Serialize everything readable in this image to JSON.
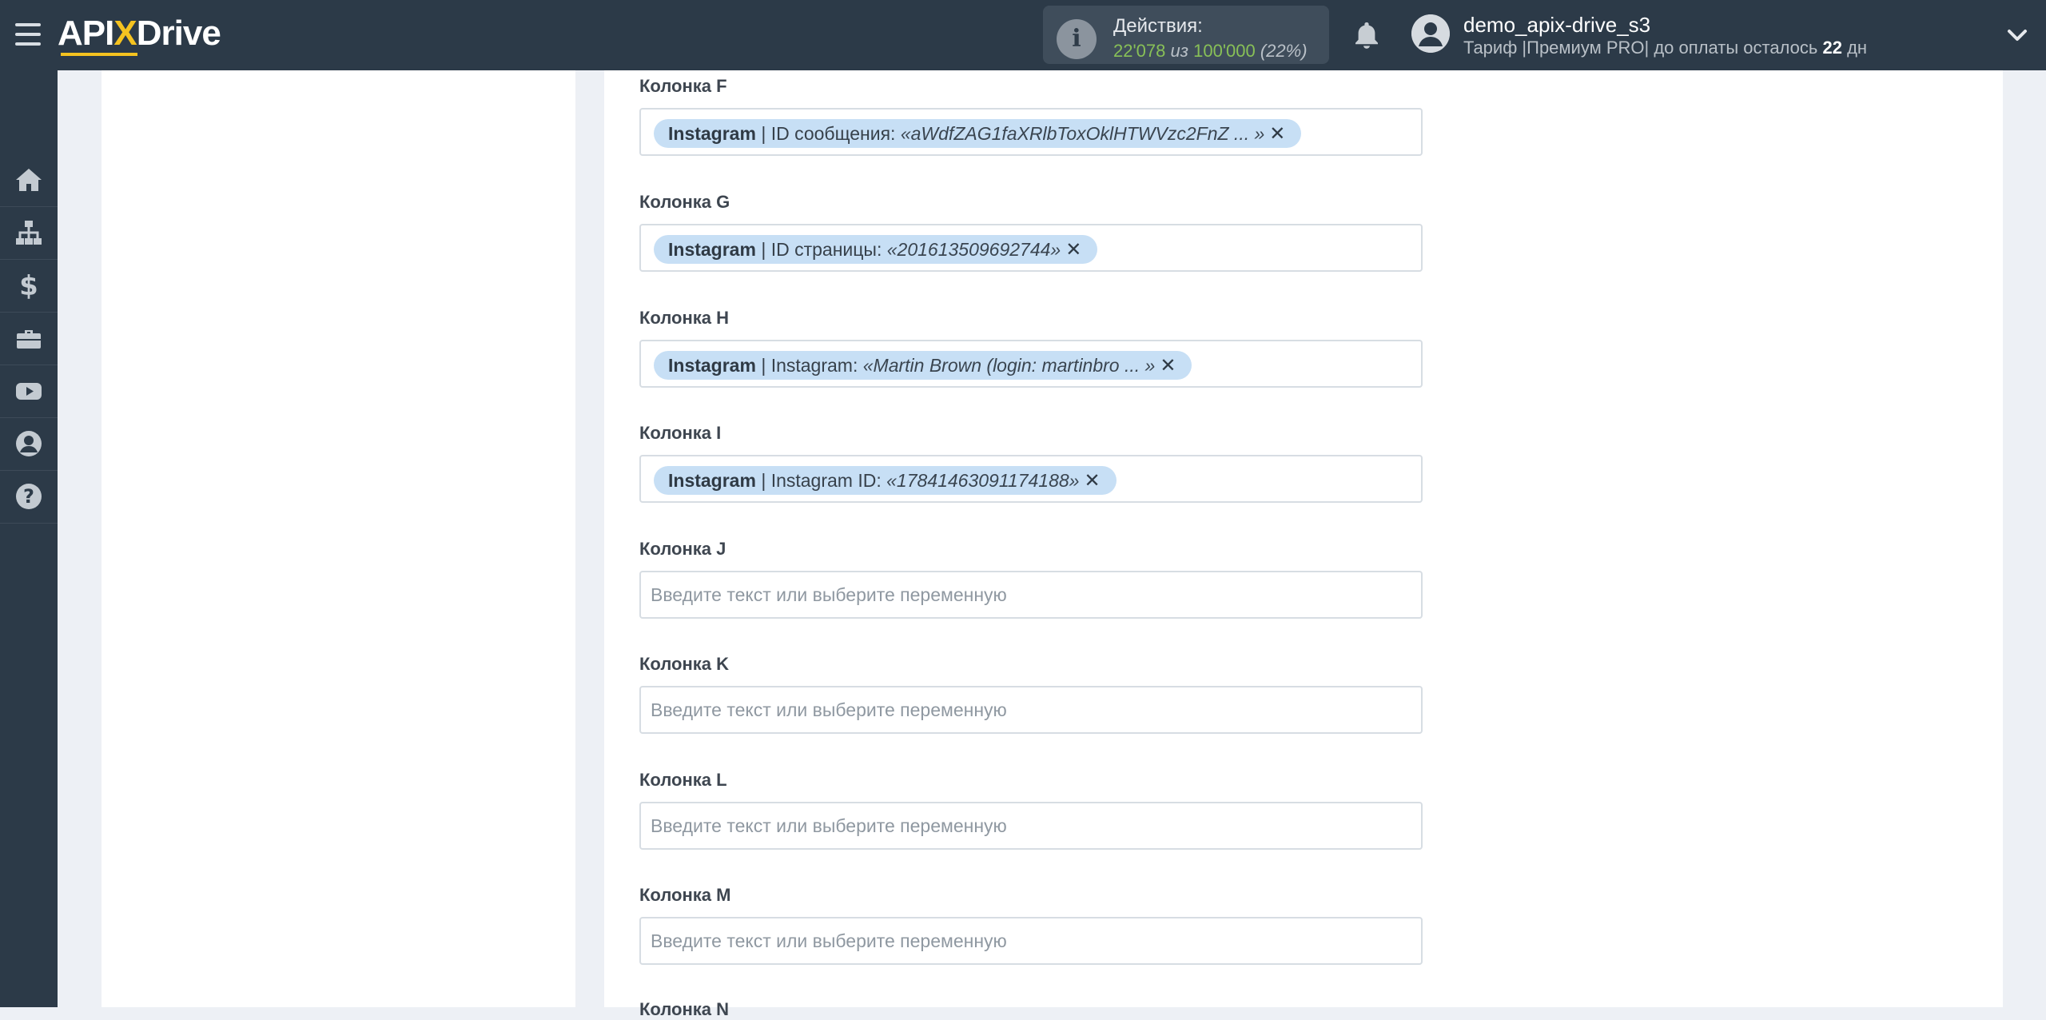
{
  "header": {
    "logo": {
      "part1": "API",
      "part2": "X",
      "part3": "Drive"
    },
    "actions": {
      "title": "Действия:",
      "used": "22'078",
      "sep": "из",
      "total": "100'000",
      "percent": "(22%)"
    },
    "user": {
      "name": "demo_apix-drive_s3",
      "tariff_prefix": "Тариф |Премиум PRO| до оплаты осталось",
      "days": "22",
      "days_unit": "дн"
    }
  },
  "sidebar": {
    "items": [
      {
        "icon": "home-icon"
      },
      {
        "icon": "sitemap-icon"
      },
      {
        "icon": "dollar-icon"
      },
      {
        "icon": "briefcase-icon"
      },
      {
        "icon": "youtube-icon"
      },
      {
        "icon": "user-circle-icon"
      },
      {
        "icon": "question-icon"
      }
    ]
  },
  "fields": [
    {
      "label": "Колонка F",
      "tag": {
        "source": "Instagram",
        "name": "| ID сообщения:",
        "value": "«aWdfZAG1faXRlbToxOklHTWVzc2FnZ ... »"
      }
    },
    {
      "label": "Колонка G",
      "tag": {
        "source": "Instagram",
        "name": "| ID страницы:",
        "value": "«201613509692744»"
      }
    },
    {
      "label": "Колонка H",
      "tag": {
        "source": "Instagram",
        "name": "| Instagram:",
        "value": "«Martin Brown (login: martinbro ... »"
      }
    },
    {
      "label": "Колонка I",
      "tag": {
        "source": "Instagram",
        "name": "| Instagram ID:",
        "value": "«17841463091174188»"
      }
    },
    {
      "label": "Колонка J",
      "placeholder": "Введите текст или выберите переменную"
    },
    {
      "label": "Колонка K",
      "placeholder": "Введите текст или выберите переменную"
    },
    {
      "label": "Колонка L",
      "placeholder": "Введите текст или выберите переменную"
    },
    {
      "label": "Колонка M",
      "placeholder": "Введите текст или выберите переменную"
    }
  ],
  "next_label": "Колонка N",
  "colors": {
    "topbar": "#2c3a48",
    "accent": "#f5c320",
    "tag": "#c7dff5",
    "count_green": "#88c057"
  }
}
